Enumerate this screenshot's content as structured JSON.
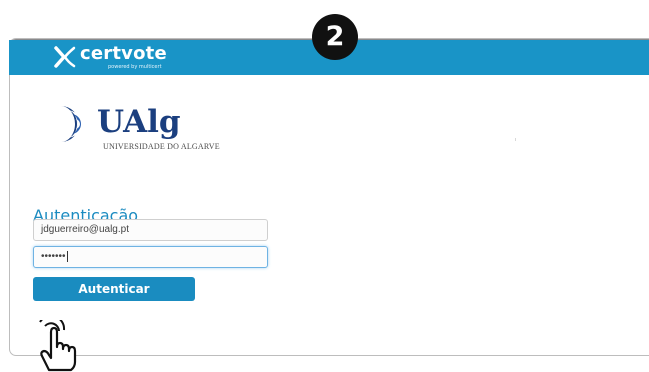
{
  "step_badge": "2",
  "window": {
    "controls": [
      "dot",
      "dot",
      "dot"
    ]
  },
  "header": {
    "logo_text": "certvote",
    "logo_subtext": "powered by multicert",
    "logo_icon": "x-logo-icon",
    "background_color": "#1994c7"
  },
  "institution": {
    "name": "UAlg",
    "subtitle": "UNIVERSIDADE DO ALGARVE",
    "logo_icon": "ualg-crescent-logo",
    "brand_color": "#1b3f7f"
  },
  "login": {
    "title": "Autenticação",
    "email_value": "jdguerreiro@ualg.pt",
    "password_mask": "•••••••",
    "submit_label": "Autenticar",
    "accent_color": "#1a8cc0"
  },
  "cursor": {
    "icon": "hand-pointer-icon"
  }
}
